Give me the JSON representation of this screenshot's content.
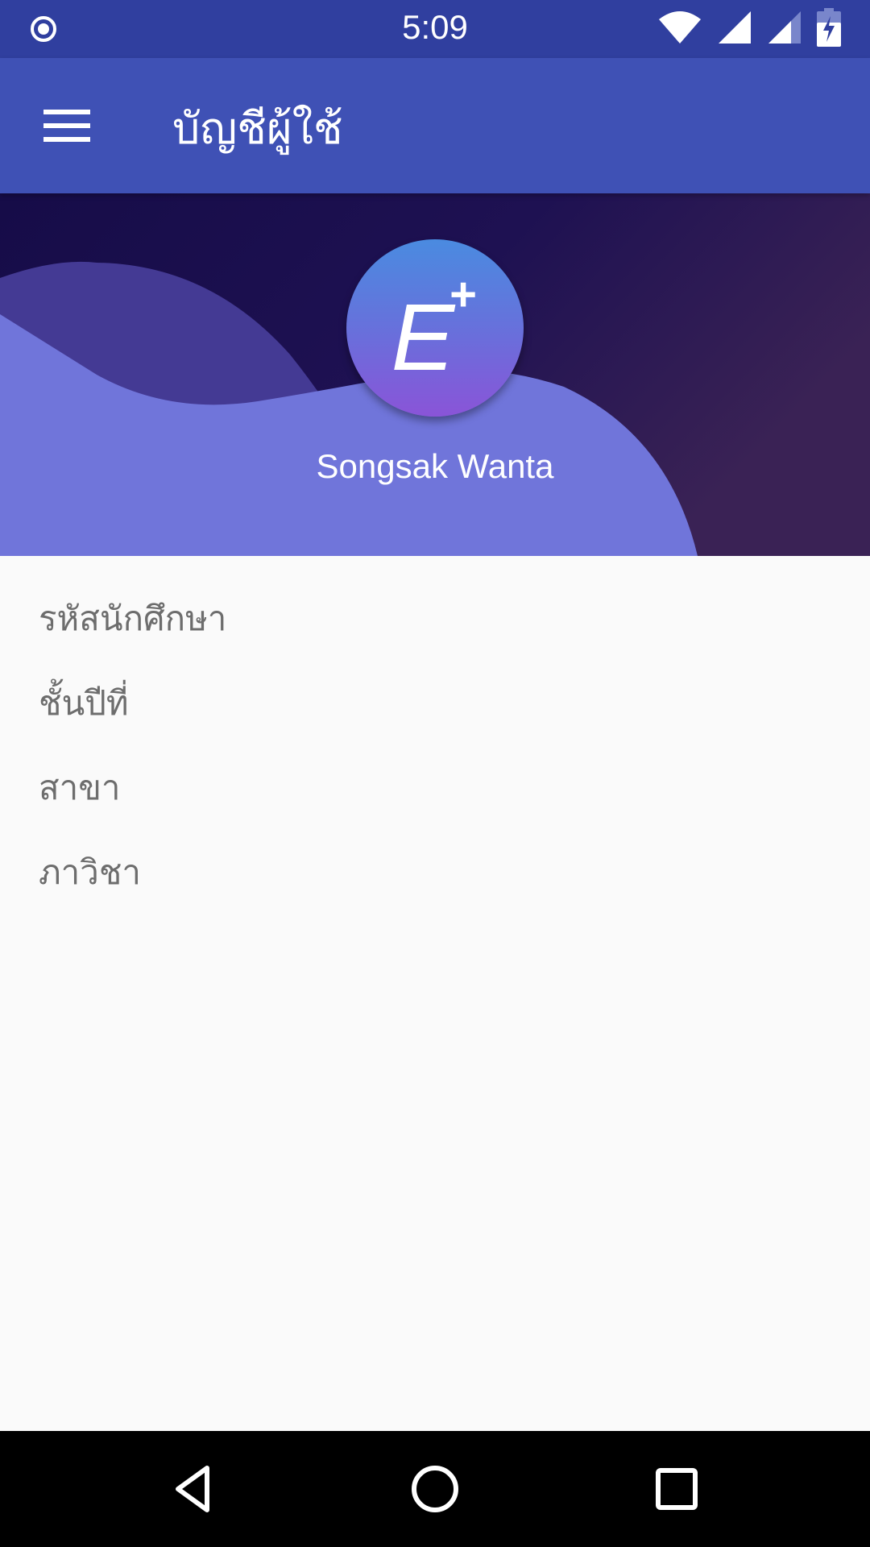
{
  "status_bar": {
    "time": "5:09",
    "icons": [
      "radio-circle-icon",
      "wifi-icon",
      "signal-icon",
      "signal-icon",
      "battery-charging-icon"
    ]
  },
  "app_bar": {
    "title": "บัญชีผู้ใช้",
    "menu_icon": "hamburger-menu-icon"
  },
  "profile": {
    "avatar_letter": "E",
    "avatar_plus": "+",
    "name": "Songsak Wanta"
  },
  "info_fields": [
    {
      "label": "รหัสนักศึกษา"
    },
    {
      "label": "ชั้นปีที่"
    },
    {
      "label": "สาขา"
    },
    {
      "label": "ภาวิชา"
    }
  ],
  "nav_bar": {
    "icons": [
      "back-icon",
      "home-icon",
      "recents-icon"
    ]
  },
  "colors": {
    "status_bar": "#303F9F",
    "app_bar": "#3F51B5",
    "banner_dark": "#1C1050",
    "banner_wave": "#7075DA",
    "background": "#FAFAFA"
  }
}
